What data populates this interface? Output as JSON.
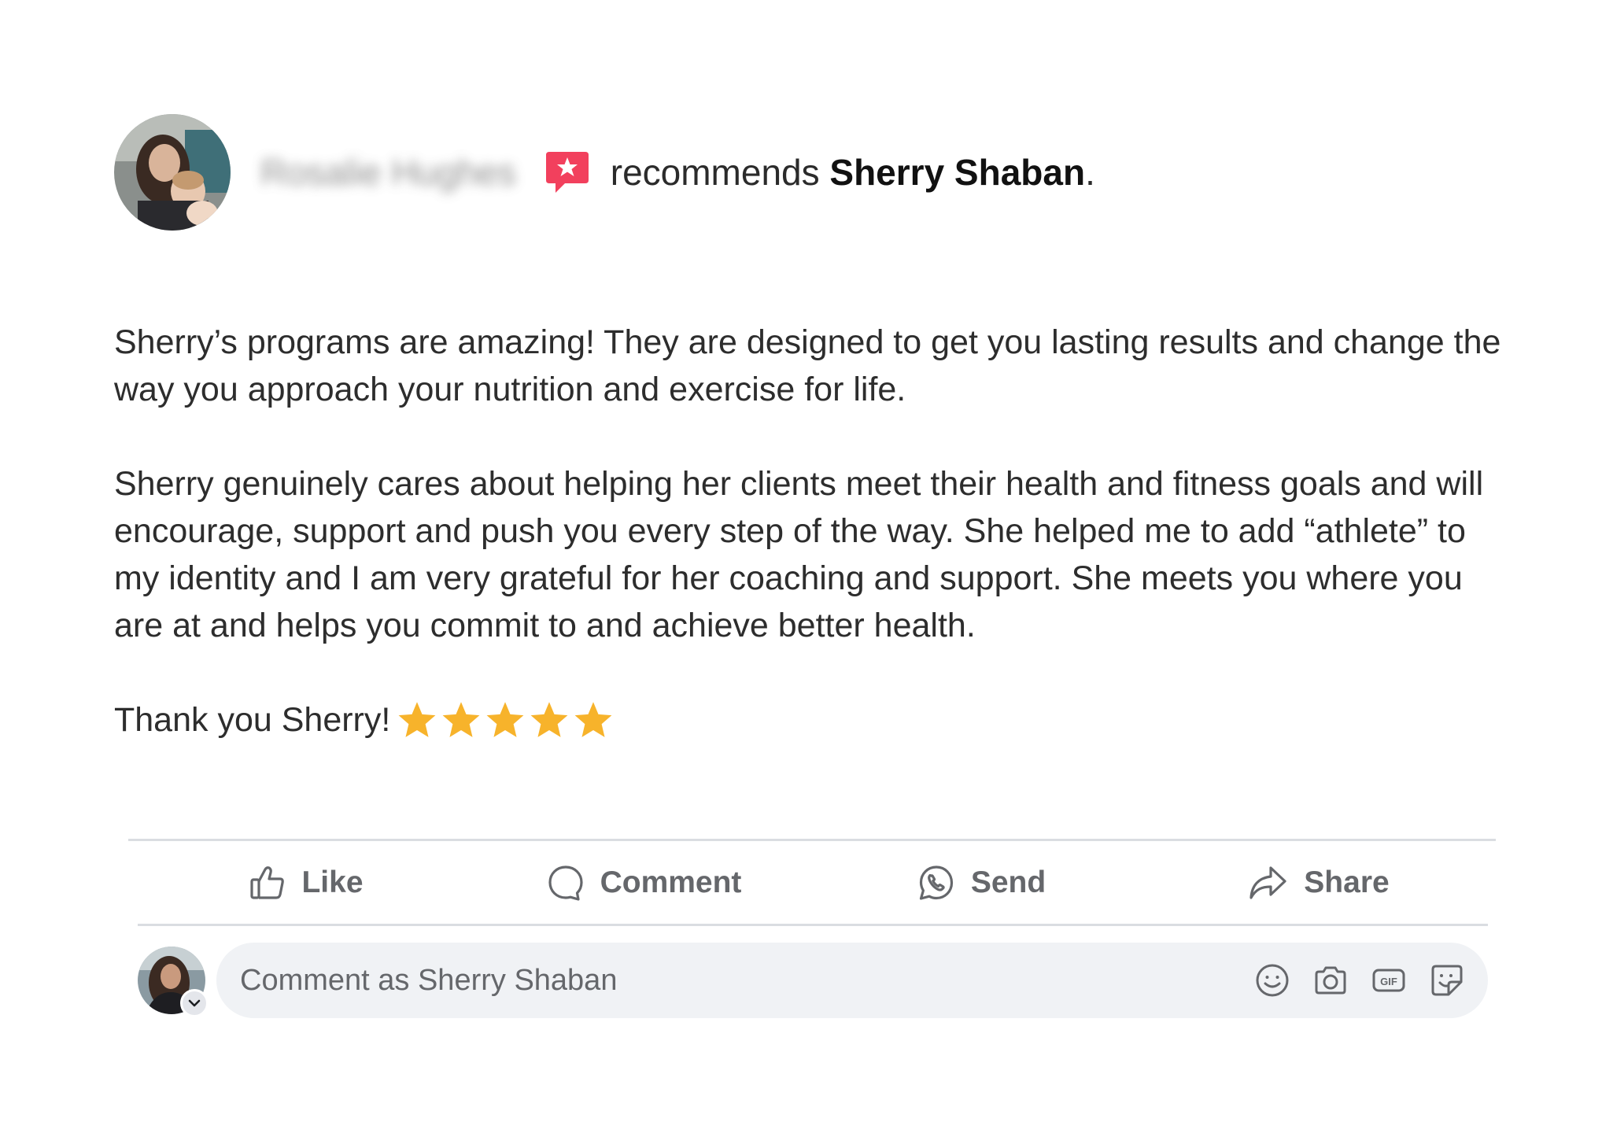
{
  "post": {
    "reviewer_name": "Rosalie Hughes",
    "recommend_verb": "recommends",
    "page_name": "Sherry Shaban",
    "period": "."
  },
  "review": {
    "paragraph_1": "Sherry’s programs are amazing! They are designed to get you lasting results and change the way you approach your nutrition and exercise for life.",
    "paragraph_2": "Sherry genuinely cares about helping her clients meet their health and fitness goals and will encourage, support and push you every step of the way. She helped me to add “athlete” to my identity and I am very grateful for her coaching and support. She meets you where you are at and helps you commit to and achieve better health.",
    "thanks": "Thank you Sherry!",
    "rating": 5,
    "star_color": "#f7b32b"
  },
  "actions": {
    "like": "Like",
    "comment": "Comment",
    "send": "Send",
    "share": "Share"
  },
  "comment_box": {
    "placeholder": "Comment as Sherry Shaban",
    "tools": [
      "emoji-icon",
      "camera-icon",
      "gif-icon",
      "sticker-icon"
    ]
  },
  "colors": {
    "recommend_badge": "#f2405d",
    "action_text": "#65676b",
    "comment_bg": "#f0f2f5",
    "divider": "#dadde1"
  }
}
